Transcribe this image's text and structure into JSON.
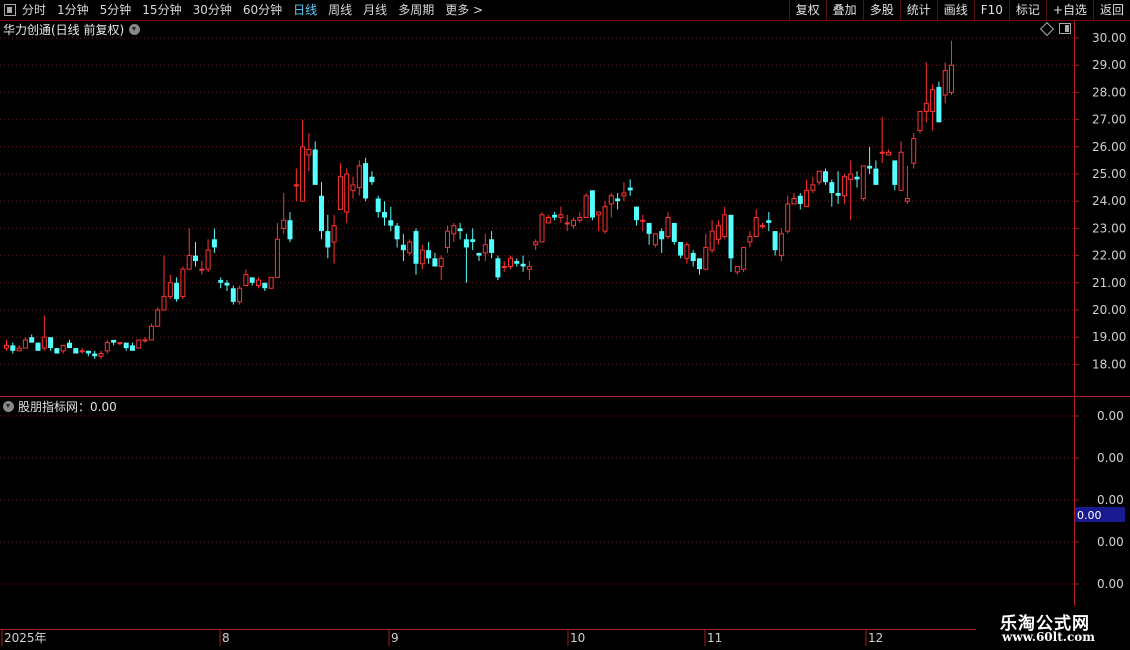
{
  "toolbar": {
    "periods": [
      "分时",
      "1分钟",
      "5分钟",
      "15分钟",
      "30分钟",
      "60分钟",
      "日线",
      "周线",
      "月线",
      "多周期",
      "更多 >"
    ],
    "active_index": 6,
    "buttons": [
      "复权",
      "叠加",
      "多股",
      "统计",
      "画线",
      "F10",
      "标记",
      "+自选",
      "返回"
    ]
  },
  "chart_header": {
    "title": "华力创通(日线 前复权)"
  },
  "price_axis": {
    "ticks": [
      "30.00",
      "29.00",
      "28.00",
      "27.00",
      "26.00",
      "25.00",
      "24.00",
      "23.00",
      "22.00",
      "21.00",
      "20.00",
      "19.00",
      "18.00"
    ]
  },
  "indicator": {
    "title": "股朋指标网：0.00",
    "ticks": [
      "0.00",
      "0.00",
      "0.00",
      "0.00",
      "0.00"
    ],
    "current_value": "0.00"
  },
  "time_axis": {
    "labels": [
      "2025年",
      "8",
      "9",
      "10",
      "11",
      "12"
    ]
  },
  "logo": {
    "main": "乐淘公式网",
    "sub": "www.60lt.com"
  },
  "colors": {
    "up": "#ff3232",
    "down": "#54ffff",
    "grid": "#6a1a1a",
    "axis": "#a02020",
    "highlight": "#1a1a90"
  },
  "chart_data": {
    "type": "candlestick",
    "title": "华力创通(日线 前复权)",
    "ylim": [
      17.6,
      30.3
    ],
    "candles": [
      [
        18.6,
        18.9,
        18.5,
        18.7
      ],
      [
        18.7,
        18.8,
        18.4,
        18.5
      ],
      [
        18.5,
        18.7,
        18.5,
        18.6
      ],
      [
        18.6,
        19.0,
        18.6,
        18.9
      ],
      [
        19.0,
        19.1,
        18.8,
        18.8
      ],
      [
        18.8,
        18.8,
        18.5,
        18.5
      ],
      [
        18.6,
        19.8,
        18.5,
        19.0
      ],
      [
        19.0,
        19.0,
        18.5,
        18.6
      ],
      [
        18.6,
        18.6,
        18.4,
        18.4
      ],
      [
        18.5,
        18.7,
        18.4,
        18.7
      ],
      [
        18.8,
        18.9,
        18.6,
        18.6
      ],
      [
        18.6,
        18.6,
        18.4,
        18.4
      ],
      [
        18.5,
        18.6,
        18.4,
        18.5
      ],
      [
        18.5,
        18.5,
        18.3,
        18.4
      ],
      [
        18.4,
        18.5,
        18.2,
        18.3
      ],
      [
        18.3,
        18.5,
        18.2,
        18.4
      ],
      [
        18.5,
        18.9,
        18.4,
        18.8
      ],
      [
        18.9,
        18.9,
        18.7,
        18.8
      ],
      [
        18.8,
        18.8,
        18.7,
        18.8
      ],
      [
        18.8,
        18.8,
        18.5,
        18.6
      ],
      [
        18.7,
        18.8,
        18.5,
        18.5
      ],
      [
        18.6,
        18.9,
        18.6,
        18.9
      ],
      [
        18.9,
        19.0,
        18.8,
        18.9
      ],
      [
        18.9,
        19.5,
        18.9,
        19.4
      ],
      [
        19.4,
        20.1,
        19.4,
        20.0
      ],
      [
        20.0,
        22.0,
        20.0,
        20.5
      ],
      [
        20.5,
        21.3,
        20.4,
        21.0
      ],
      [
        21.0,
        21.2,
        20.3,
        20.4
      ],
      [
        20.5,
        21.6,
        20.4,
        21.5
      ],
      [
        21.5,
        23.0,
        21.5,
        22.0
      ],
      [
        22.0,
        22.5,
        21.6,
        21.8
      ],
      [
        21.5,
        21.8,
        21.3,
        21.5
      ],
      [
        21.5,
        22.6,
        21.4,
        22.2
      ],
      [
        22.6,
        23.0,
        22.1,
        22.3
      ],
      [
        21.1,
        21.2,
        20.8,
        21.0
      ],
      [
        21.0,
        21.1,
        20.7,
        20.9
      ],
      [
        20.8,
        20.9,
        20.2,
        20.3
      ],
      [
        20.3,
        20.9,
        20.2,
        20.8
      ],
      [
        20.9,
        21.5,
        20.9,
        21.3
      ],
      [
        21.2,
        21.2,
        20.9,
        21.0
      ],
      [
        20.9,
        21.2,
        20.8,
        21.1
      ],
      [
        21.0,
        21.0,
        20.7,
        20.8
      ],
      [
        20.8,
        21.2,
        20.8,
        21.2
      ],
      [
        21.2,
        23.2,
        21.2,
        22.6
      ],
      [
        23.0,
        24.3,
        22.8,
        23.3
      ],
      [
        23.3,
        23.6,
        22.5,
        22.6
      ],
      [
        24.6,
        25.2,
        24.0,
        24.6
      ],
      [
        24.0,
        27.0,
        24.0,
        26.0
      ],
      [
        25.7,
        26.5,
        25.1,
        25.9
      ],
      [
        25.9,
        26.2,
        24.6,
        24.6
      ],
      [
        24.2,
        24.7,
        22.6,
        22.9
      ],
      [
        22.9,
        23.5,
        21.9,
        22.3
      ],
      [
        22.5,
        23.5,
        21.7,
        23.1
      ],
      [
        23.7,
        25.4,
        23.7,
        24.9
      ],
      [
        23.6,
        25.2,
        23.2,
        25.0
      ],
      [
        24.4,
        24.9,
        24.1,
        24.6
      ],
      [
        24.5,
        25.5,
        24.2,
        25.3
      ],
      [
        25.4,
        25.6,
        24.0,
        24.1
      ],
      [
        24.9,
        25.1,
        24.6,
        24.7
      ],
      [
        24.1,
        24.2,
        23.4,
        23.6
      ],
      [
        23.6,
        24.0,
        23.1,
        23.4
      ],
      [
        23.3,
        23.8,
        22.9,
        23.1
      ],
      [
        23.1,
        23.2,
        22.3,
        22.6
      ],
      [
        22.4,
        22.8,
        21.8,
        22.2
      ],
      [
        22.1,
        22.6,
        22.0,
        22.5
      ],
      [
        22.9,
        23.0,
        21.3,
        21.7
      ],
      [
        21.7,
        22.4,
        21.5,
        22.2
      ],
      [
        22.2,
        22.5,
        21.7,
        21.9
      ],
      [
        21.9,
        22.1,
        21.6,
        21.6
      ],
      [
        21.6,
        22.0,
        21.1,
        21.9
      ],
      [
        22.3,
        23.1,
        22.1,
        22.9
      ],
      [
        22.8,
        23.2,
        22.5,
        23.1
      ],
      [
        23.0,
        23.2,
        22.6,
        22.9
      ],
      [
        22.6,
        22.8,
        21.0,
        22.3
      ],
      [
        22.6,
        23.0,
        22.2,
        22.5
      ],
      [
        22.1,
        22.1,
        21.8,
        22.0
      ],
      [
        22.1,
        22.8,
        21.8,
        22.4
      ],
      [
        22.6,
        22.9,
        21.9,
        22.1
      ],
      [
        21.9,
        22.0,
        21.1,
        21.2
      ],
      [
        21.6,
        21.8,
        21.4,
        21.6
      ],
      [
        21.6,
        22.0,
        21.5,
        21.9
      ],
      [
        21.8,
        21.9,
        21.6,
        21.7
      ],
      [
        21.7,
        22.0,
        21.4,
        21.6
      ],
      [
        21.5,
        21.8,
        21.1,
        21.6
      ],
      [
        22.4,
        22.6,
        22.2,
        22.5
      ],
      [
        22.5,
        23.6,
        22.5,
        23.5
      ],
      [
        23.2,
        23.5,
        23.2,
        23.4
      ],
      [
        23.5,
        23.6,
        23.3,
        23.4
      ],
      [
        23.4,
        23.8,
        23.2,
        23.5
      ],
      [
        23.2,
        23.5,
        22.9,
        23.2
      ],
      [
        23.1,
        23.4,
        23.0,
        23.3
      ],
      [
        23.3,
        23.6,
        23.2,
        23.4
      ],
      [
        23.4,
        24.3,
        23.4,
        24.2
      ],
      [
        24.4,
        24.4,
        23.3,
        23.4
      ],
      [
        23.5,
        23.6,
        22.9,
        23.6
      ],
      [
        22.9,
        24.0,
        22.8,
        23.8
      ],
      [
        23.9,
        24.3,
        23.4,
        24.2
      ],
      [
        24.1,
        24.3,
        23.7,
        24.0
      ],
      [
        24.2,
        24.7,
        24.0,
        24.3
      ],
      [
        24.5,
        24.8,
        24.2,
        24.4
      ],
      [
        23.8,
        23.8,
        23.1,
        23.3
      ],
      [
        23.3,
        23.5,
        22.9,
        23.3
      ],
      [
        23.2,
        23.2,
        22.4,
        22.8
      ],
      [
        22.4,
        22.8,
        22.3,
        22.8
      ],
      [
        22.9,
        23.0,
        22.1,
        22.6
      ],
      [
        22.7,
        23.6,
        22.6,
        23.4
      ],
      [
        23.2,
        23.2,
        22.4,
        22.5
      ],
      [
        22.5,
        22.5,
        21.9,
        22.0
      ],
      [
        21.9,
        22.5,
        21.7,
        22.4
      ],
      [
        22.1,
        22.2,
        21.6,
        21.8
      ],
      [
        21.9,
        21.9,
        21.3,
        21.5
      ],
      [
        21.5,
        22.8,
        21.5,
        22.3
      ],
      [
        22.2,
        23.3,
        22.1,
        22.9
      ],
      [
        22.6,
        23.3,
        22.4,
        23.1
      ],
      [
        22.7,
        23.8,
        22.6,
        23.5
      ],
      [
        23.5,
        23.5,
        21.4,
        21.9
      ],
      [
        21.4,
        21.6,
        21.3,
        21.6
      ],
      [
        21.5,
        22.3,
        21.4,
        22.3
      ],
      [
        22.5,
        22.9,
        22.3,
        22.7
      ],
      [
        22.7,
        23.7,
        22.7,
        23.4
      ],
      [
        23.1,
        23.2,
        23.0,
        23.1
      ],
      [
        23.3,
        23.6,
        22.9,
        23.2
      ],
      [
        22.9,
        22.9,
        22.0,
        22.2
      ],
      [
        22.0,
        23.0,
        21.8,
        22.8
      ],
      [
        22.9,
        24.2,
        22.8,
        23.9
      ],
      [
        23.9,
        24.3,
        23.9,
        24.1
      ],
      [
        24.2,
        24.3,
        23.7,
        23.9
      ],
      [
        23.8,
        24.8,
        23.8,
        24.4
      ],
      [
        24.4,
        24.9,
        24.3,
        24.6
      ],
      [
        24.7,
        25.1,
        24.6,
        25.1
      ],
      [
        25.1,
        25.2,
        24.6,
        24.7
      ],
      [
        24.7,
        24.8,
        23.8,
        24.3
      ],
      [
        24.3,
        25.1,
        23.9,
        24.2
      ],
      [
        24.2,
        25.0,
        23.9,
        24.9
      ],
      [
        24.8,
        25.5,
        23.3,
        25.0
      ],
      [
        24.9,
        25.1,
        24.5,
        24.8
      ],
      [
        24.1,
        25.3,
        24.0,
        25.3
      ],
      [
        25.3,
        26.0,
        25.0,
        25.2
      ],
      [
        25.2,
        25.5,
        24.6,
        24.6
      ],
      [
        25.8,
        27.1,
        25.4,
        25.8
      ],
      [
        25.7,
        25.9,
        25.7,
        25.8
      ],
      [
        25.5,
        25.5,
        24.4,
        24.6
      ],
      [
        24.4,
        26.2,
        24.4,
        25.8
      ],
      [
        24.0,
        25.3,
        23.9,
        24.1
      ],
      [
        25.4,
        26.5,
        25.2,
        26.3
      ],
      [
        26.6,
        27.1,
        26.5,
        27.3
      ],
      [
        27.3,
        29.1,
        26.9,
        27.6
      ],
      [
        27.3,
        28.3,
        26.6,
        28.1
      ],
      [
        28.2,
        28.4,
        27.0,
        26.9
      ],
      [
        27.9,
        29.1,
        27.6,
        28.8
      ],
      [
        28.0,
        29.9,
        27.9,
        29.0
      ]
    ]
  }
}
